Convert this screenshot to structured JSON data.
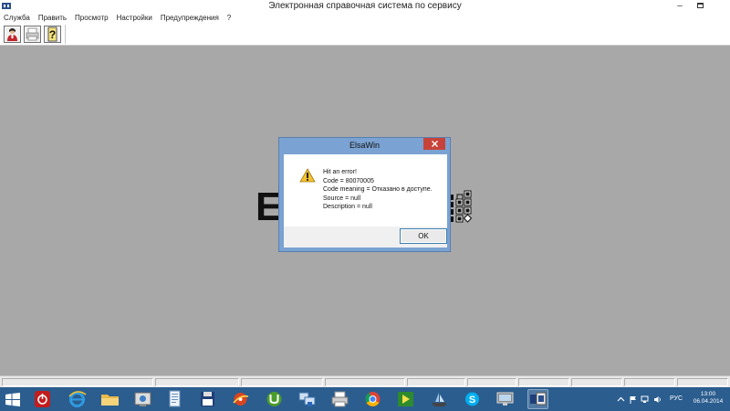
{
  "window": {
    "title": "Электронная справочная система по сервису",
    "minimize_glyph": "–",
    "icon": "app-icon"
  },
  "menu": {
    "items": [
      "Служба",
      "Править",
      "Просмотр",
      "Настройки",
      "Предупреждения",
      "?"
    ]
  },
  "toolbar": {
    "buttons": [
      {
        "icon": "user-icon"
      },
      {
        "icon": "printer-icon"
      },
      {
        "icon": "help-icon"
      }
    ]
  },
  "logo": {
    "letter": "E"
  },
  "dialog": {
    "title": "ElsaWin",
    "message_lines": [
      "Hit an error!",
      "Code = 80070005",
      "Code meaning = Отказано в доступе.",
      "Source = null",
      "Description = null"
    ],
    "ok_label": "OK",
    "icon": "warning-icon"
  },
  "taskbar": {
    "icons": [
      "power-icon",
      "ie-icon",
      "folder-icon",
      "control-panel-icon",
      "document-icon",
      "floppy-icon",
      "media-icon",
      "utorrent-icon",
      "network-icon",
      "printer-icon",
      "chrome-icon",
      "green-app-icon",
      "ship-icon",
      "skype-icon",
      "screen-icon",
      "elsawin-icon"
    ],
    "language": "РУС",
    "time": "13:00",
    "date": "06.04.2014"
  },
  "colors": {
    "workspace": "#a8a8a8",
    "taskbar": "#2b5d8f",
    "dialog_frame": "#7aa2d2",
    "close_button": "#c7433a"
  }
}
